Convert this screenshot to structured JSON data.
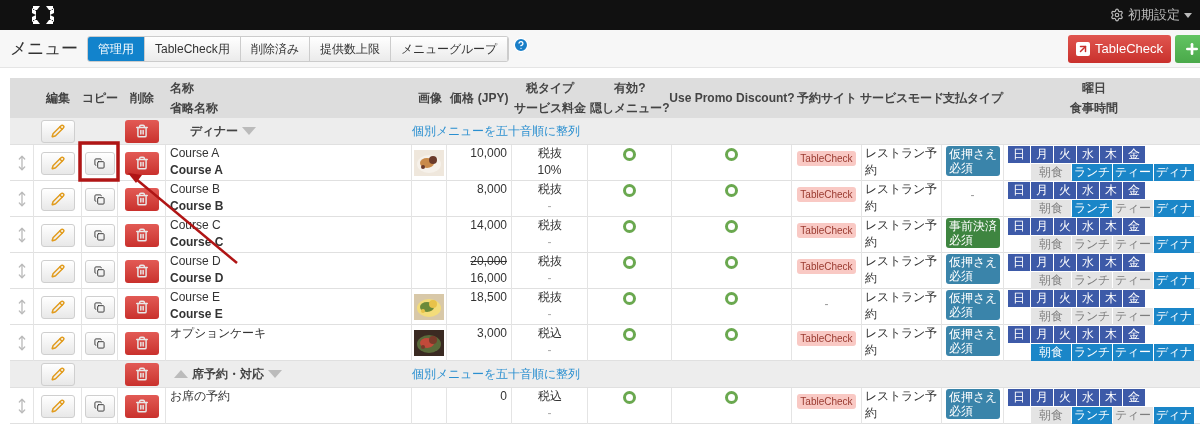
{
  "topbar": {
    "settings_label": "初期設定"
  },
  "page": {
    "title": "メニュー",
    "tabs": [
      {
        "label": "管理用",
        "selected": true
      },
      {
        "label": "TableCheck用",
        "selected": false
      },
      {
        "label": "削除済み",
        "selected": false
      },
      {
        "label": "提供数上限",
        "selected": false
      },
      {
        "label": "メニューグループ",
        "selected": false
      }
    ],
    "tablecheck_button": "TableCheck"
  },
  "table": {
    "columns": [
      {
        "lines": [
          "編集"
        ]
      },
      {
        "lines": [
          "コピー"
        ]
      },
      {
        "lines": [
          "削除"
        ]
      },
      {
        "lines": [
          "名称",
          "省略名称"
        ]
      },
      {
        "lines": [
          "画像"
        ]
      },
      {
        "lines": [
          "価格 (JPY)"
        ]
      },
      {
        "lines": [
          "税タイプ",
          "サービス料金"
        ]
      },
      {
        "lines": [
          "有効?",
          "隠しメニュー?"
        ]
      },
      {
        "lines": [
          "Use Promo Discount?"
        ]
      },
      {
        "lines": [
          "予約サイト"
        ]
      },
      {
        "lines": [
          "サービスモード"
        ]
      },
      {
        "lines": [
          "支払タイプ"
        ]
      },
      {
        "lines": [
          "曜日",
          "食事時間"
        ]
      }
    ],
    "rows": [
      {
        "kind": "group",
        "name": "ディナー",
        "show_up": false,
        "sort_link": "個別メニューを五十音順に整列"
      },
      {
        "kind": "item",
        "name": "Course A",
        "short_name": "Course A",
        "picture": true,
        "old_price": "",
        "price": "10,000",
        "tax": "税抜",
        "service": "10%",
        "active": true,
        "promo": true,
        "site": {
          "kind": "badge",
          "label": "TableCheck"
        },
        "mode": "レストラン予約",
        "payment": {
          "kind": "badge",
          "label": "仮押さえ必須",
          "color": "#3a84aa"
        },
        "days": [
          "日",
          "月",
          "火",
          "水",
          "木",
          "金"
        ],
        "meals": [
          {
            "label": "朝食",
            "on": false
          },
          {
            "label": "ランチ",
            "on": true
          },
          {
            "label": "ティー",
            "on": true
          },
          {
            "label": "ディナ",
            "on": true
          }
        ]
      },
      {
        "kind": "item",
        "name": "Course B",
        "short_name": "Course B",
        "picture": false,
        "old_price": "",
        "price": "8,000",
        "tax": "税抜",
        "service": "-",
        "active": true,
        "promo": true,
        "site": {
          "kind": "badge",
          "label": "TableCheck"
        },
        "mode": "レストラン予約",
        "payment": {
          "kind": "plain",
          "label": "-"
        },
        "days": [
          "日",
          "月",
          "火",
          "水",
          "木",
          "金"
        ],
        "meals": [
          {
            "label": "朝食",
            "on": false
          },
          {
            "label": "ランチ",
            "on": true
          },
          {
            "label": "ティー",
            "on": false
          },
          {
            "label": "ディナ",
            "on": true
          }
        ]
      },
      {
        "kind": "item",
        "name": "Course C",
        "short_name": "Course C",
        "picture": false,
        "old_price": "",
        "price": "14,000",
        "tax": "税抜",
        "service": "-",
        "active": true,
        "promo": true,
        "site": {
          "kind": "badge",
          "label": "TableCheck"
        },
        "mode": "レストラン予約",
        "payment": {
          "kind": "badge",
          "label": "事前決済必須",
          "color": "#3e8540"
        },
        "days": [
          "日",
          "月",
          "火",
          "水",
          "木",
          "金"
        ],
        "meals": [
          {
            "label": "朝食",
            "on": false
          },
          {
            "label": "ランチ",
            "on": false
          },
          {
            "label": "ティー",
            "on": false
          },
          {
            "label": "ディナ",
            "on": true
          }
        ]
      },
      {
        "kind": "item",
        "name": "Course D",
        "short_name": "Course D",
        "picture": false,
        "old_price": "20,000",
        "price": "16,000",
        "tax": "税抜",
        "service": "-",
        "active": true,
        "promo": true,
        "site": {
          "kind": "badge",
          "label": "TableCheck"
        },
        "mode": "レストラン予約",
        "payment": {
          "kind": "badge",
          "label": "仮押さえ必須",
          "color": "#3a84aa"
        },
        "days": [
          "日",
          "月",
          "火",
          "水",
          "木",
          "金"
        ],
        "meals": [
          {
            "label": "朝食",
            "on": false
          },
          {
            "label": "ランチ",
            "on": false
          },
          {
            "label": "ティー",
            "on": false
          },
          {
            "label": "ディナ",
            "on": true
          }
        ]
      },
      {
        "kind": "item",
        "name": "Course E",
        "short_name": "Course E",
        "picture": true,
        "old_price": "",
        "price": "18,500",
        "tax": "税抜",
        "service": "-",
        "active": true,
        "promo": true,
        "site": {
          "kind": "plain",
          "label": "-"
        },
        "mode": "レストラン予約",
        "payment": {
          "kind": "badge",
          "label": "仮押さえ必須",
          "color": "#3a84aa"
        },
        "days": [
          "日",
          "月",
          "火",
          "水",
          "木",
          "金"
        ],
        "meals": [
          {
            "label": "朝食",
            "on": false
          },
          {
            "label": "ランチ",
            "on": false
          },
          {
            "label": "ティー",
            "on": false
          },
          {
            "label": "ディナ",
            "on": true
          }
        ]
      },
      {
        "kind": "item",
        "name": "オプションケーキ",
        "short_name": "",
        "picture": true,
        "old_price": "",
        "price": "3,000",
        "tax": "税込",
        "service": "-",
        "active": true,
        "promo": true,
        "site": {
          "kind": "badge",
          "label": "TableCheck"
        },
        "mode": "レストラン予約",
        "payment": {
          "kind": "badge",
          "label": "仮押さえ必須",
          "color": "#3a84aa"
        },
        "days": [
          "日",
          "月",
          "火",
          "水",
          "木",
          "金"
        ],
        "meals": [
          {
            "label": "朝食",
            "on": true
          },
          {
            "label": "ランチ",
            "on": true
          },
          {
            "label": "ティー",
            "on": true
          },
          {
            "label": "ディナ",
            "on": true
          }
        ]
      },
      {
        "kind": "group",
        "name": "席予約・対応",
        "show_up": true,
        "sort_link": "個別メニューを五十音順に整列"
      },
      {
        "kind": "item",
        "name": "お席の予約",
        "short_name": "",
        "picture": false,
        "old_price": "",
        "price": "0",
        "tax": "税込",
        "service": "-",
        "active": true,
        "promo": true,
        "site": {
          "kind": "badge",
          "label": "TableCheck"
        },
        "mode": "レストラン予約",
        "payment": {
          "kind": "badge",
          "label": "仮押さえ必須",
          "color": "#3a84aa"
        },
        "days": [
          "日",
          "月",
          "火",
          "水",
          "木",
          "金"
        ],
        "meals": [
          {
            "label": "朝食",
            "on": false
          },
          {
            "label": "ランチ",
            "on": true
          },
          {
            "label": "ティー",
            "on": false
          },
          {
            "label": "ディナ",
            "on": true
          }
        ]
      }
    ]
  }
}
